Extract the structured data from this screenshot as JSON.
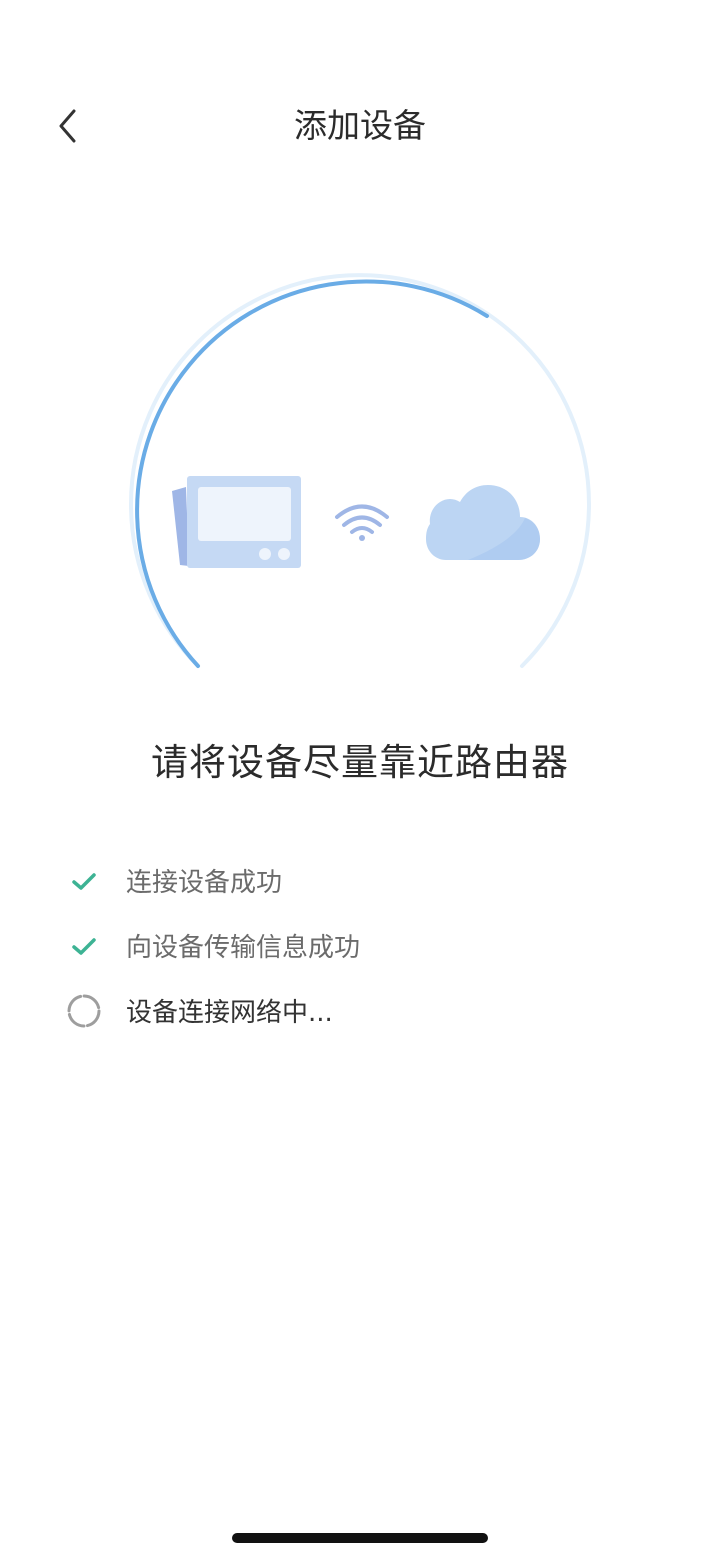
{
  "header": {
    "back_icon": "chevron-left-icon",
    "title": "添加设备"
  },
  "illustration": {
    "progress": 0.65,
    "icons": [
      "device-icon",
      "wifi-icon",
      "cloud-icon"
    ],
    "colors": {
      "arc_active": "#6aace6",
      "arc_track": "#e3f0fb",
      "device": "#c7daf4",
      "wifi": "#9fb6e6",
      "cloud": "#bcd5f3"
    }
  },
  "instruction": "请将设备尽量靠近路由器",
  "steps": [
    {
      "label": "连接设备成功",
      "status": "done",
      "icon": "checkmark-icon"
    },
    {
      "label": "向设备传输信息成功",
      "status": "done",
      "icon": "checkmark-icon"
    },
    {
      "label": "设备连接网络中...",
      "status": "in-progress",
      "icon": "spinner-icon"
    }
  ],
  "colors": {
    "check": "#3db394",
    "spinner": "#9e9e9e"
  }
}
